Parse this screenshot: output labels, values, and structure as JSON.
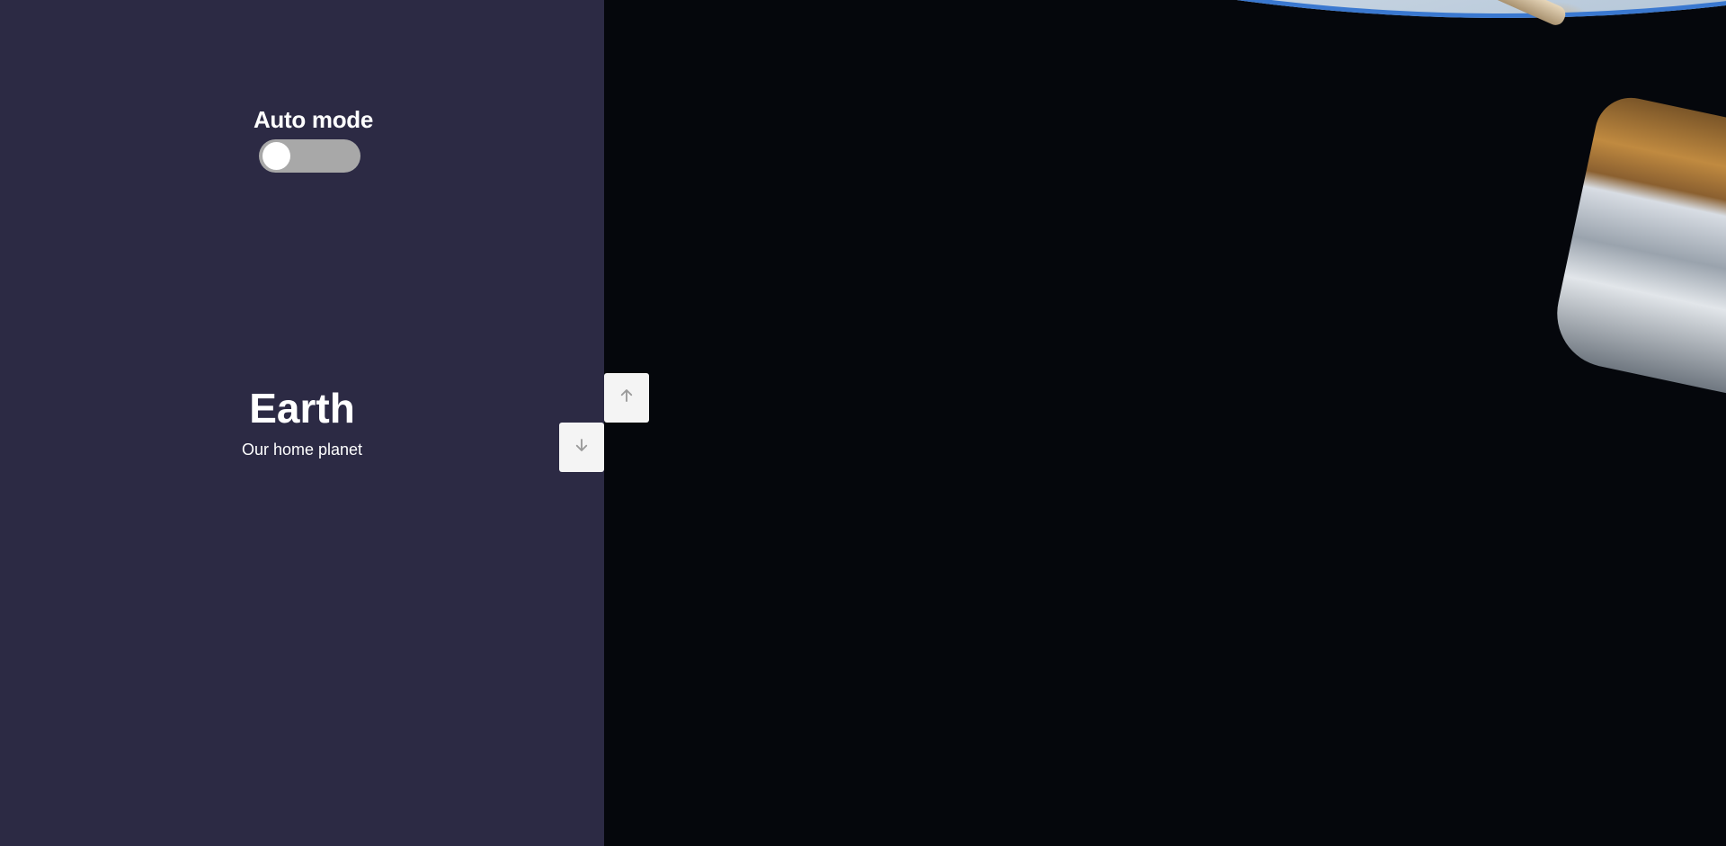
{
  "sidebar": {
    "auto_mode_label": "Auto mode",
    "auto_mode_on": false
  },
  "slide": {
    "title": "Earth",
    "subtitle": "Our home planet"
  },
  "nav": {
    "up_icon": "arrow-up-icon",
    "down_icon": "arrow-down-icon"
  },
  "colors": {
    "panel_bg": "#2c2a44",
    "toggle_off": "#a8a8a8",
    "nav_btn_bg": "#f4f4f4"
  }
}
